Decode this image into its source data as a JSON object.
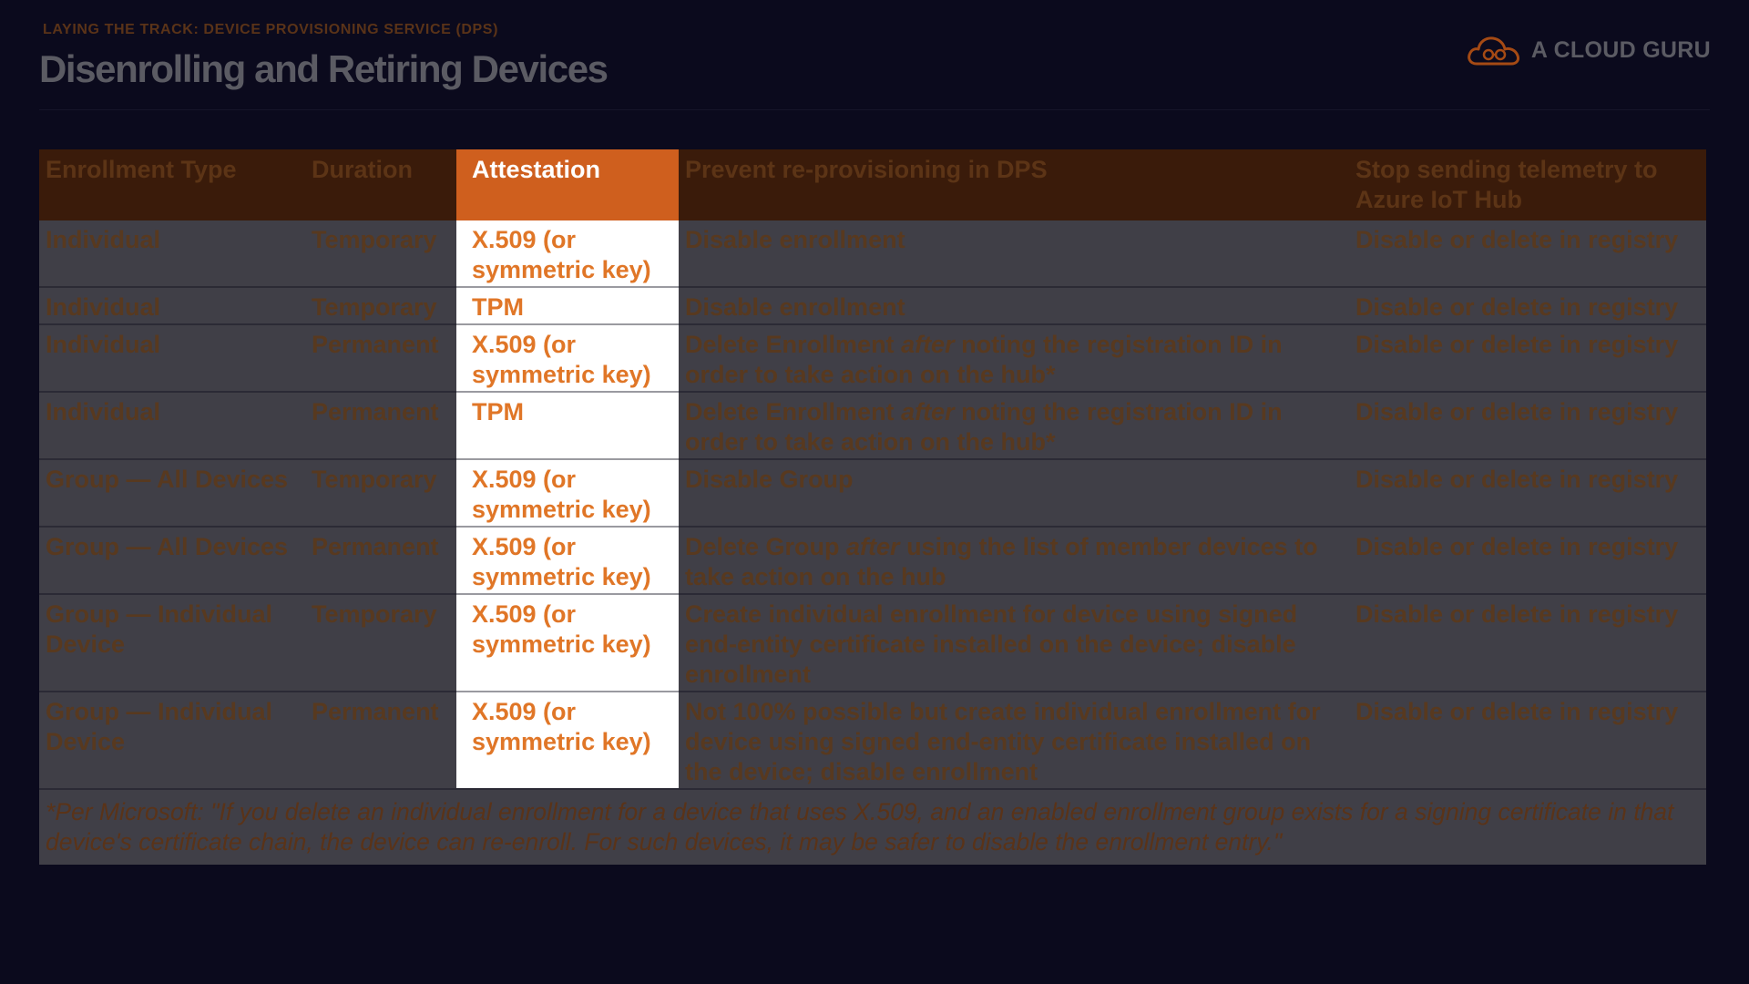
{
  "slide": {
    "kicker": "LAYING THE TRACK: DEVICE PROVISIONING SERVICE (DPS)",
    "title": "Disenrolling and Retiring Devices",
    "logo_text": "A CLOUD GURU"
  },
  "colors": {
    "background": "#0b0a1d",
    "header_row": "#3a1b0a",
    "highlight_header": "#cf5f1e",
    "highlight_cell": "#ffffff",
    "highlight_text": "#e07627",
    "row_background": "#403f47"
  },
  "table": {
    "headers": [
      "Enrollment Type",
      "Duration",
      "Attestation",
      "Prevent re-provisioning in DPS",
      "Stop sending telemetry to Azure IoT Hub"
    ],
    "rows": [
      {
        "type": "Individual",
        "duration": "Temporary",
        "attestation": "X.509 (or symmetric key)",
        "prevent_pre": "Disable enrollment",
        "prevent_em": "",
        "prevent_post": "",
        "stop": "Disable or delete in registry"
      },
      {
        "type": "Individual",
        "duration": "Temporary",
        "attestation": "TPM",
        "prevent_pre": "Disable enrollment",
        "prevent_em": "",
        "prevent_post": "",
        "stop": "Disable or delete in registry"
      },
      {
        "type": "Individual",
        "duration": "Permanent",
        "attestation": "X.509 (or symmetric key)",
        "prevent_pre": "Delete Enrollment ",
        "prevent_em": "after",
        "prevent_post": " noting the registration ID in order to take action on the hub*",
        "stop": "Disable or delete in registry"
      },
      {
        "type": "Individual",
        "duration": "Permanent",
        "attestation": "TPM",
        "prevent_pre": "Delete Enrollment ",
        "prevent_em": "after",
        "prevent_post": " noting the registration ID in order to take action on the hub*",
        "stop": "Disable or delete in registry"
      },
      {
        "type": "Group — All Devices",
        "duration": "Temporary",
        "attestation": "X.509 (or symmetric key)",
        "prevent_pre": "Disable Group",
        "prevent_em": "",
        "prevent_post": "",
        "stop": "Disable or delete in registry"
      },
      {
        "type": "Group — All Devices",
        "duration": "Permanent",
        "attestation": "X.509 (or symmetric key)",
        "prevent_pre": "Delete Group ",
        "prevent_em": "after",
        "prevent_post": " using the list of member devices to take action on the hub",
        "stop": "Disable or delete in registry"
      },
      {
        "type": "Group — Individual Device",
        "duration": "Temporary",
        "attestation": "X.509 (or symmetric key)",
        "prevent_pre": "Create individual enrollment for device using signed end-entity certificate installed on the device; disable enrollment",
        "prevent_em": "",
        "prevent_post": "",
        "stop": "Disable or delete in registry"
      },
      {
        "type": "Group — Individual Device",
        "duration": "Permanent",
        "attestation": "X.509 (or symmetric key)",
        "prevent_pre": "Not 100% possible but create individual enrollment for device using signed end-entity certificate installed on the device; disable enrollment",
        "prevent_em": "",
        "prevent_post": "",
        "stop": "Disable or delete in registry"
      }
    ],
    "footnote": "*Per Microsoft: \"If you delete an individual enrollment for a device that uses X.509, and an enabled enrollment group exists for a signing certificate in that device's certificate chain, the device can re-enroll. For such devices, it may be safer to disable the enrollment entry.\""
  }
}
